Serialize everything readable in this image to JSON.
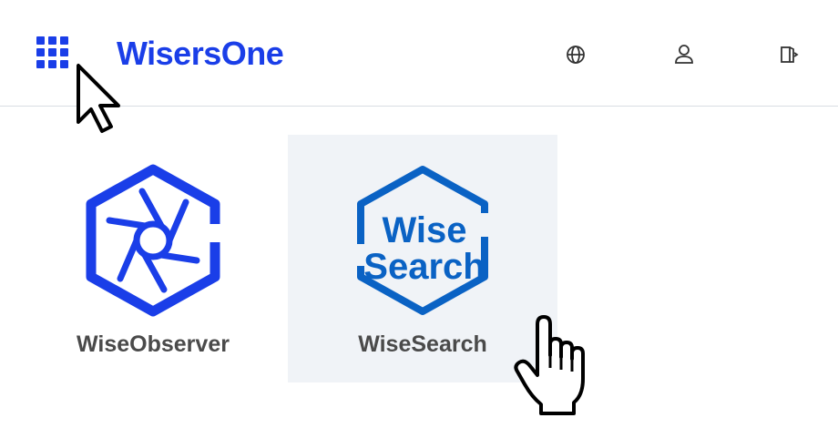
{
  "header": {
    "brand": "WisersOne",
    "brand_color": "#1a3ee8",
    "icons": [
      "apps-grid-icon",
      "globe-icon",
      "user-icon",
      "logout-icon"
    ]
  },
  "apps": [
    {
      "label": "WiseObserver",
      "icon": "wiseobserver-logo"
    },
    {
      "label": "WiseSearch",
      "icon": "wisesearch-logo",
      "logo_line1": "Wise",
      "logo_line2": "Search",
      "highlighted": true
    }
  ],
  "colors": {
    "accent": "#1a3ee8",
    "search_blue": "#0a62c4",
    "tile_hover": "#f0f3f7",
    "label": "#4a4a4a"
  }
}
